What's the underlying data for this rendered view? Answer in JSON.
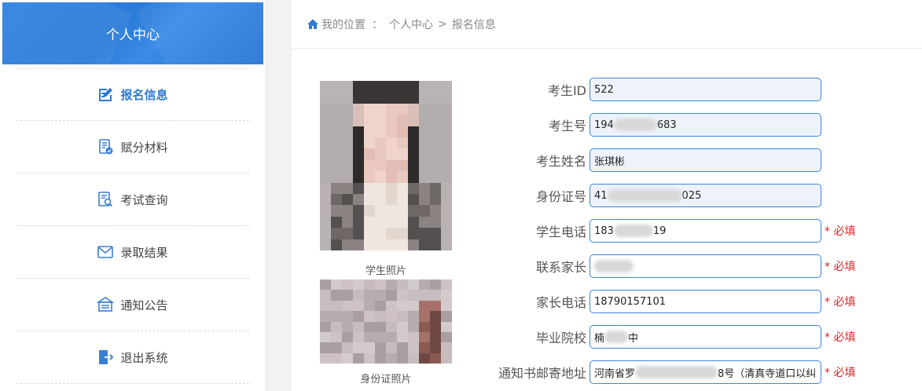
{
  "sidebar": {
    "title": "个人中心",
    "items": [
      {
        "label": "报名信息",
        "icon": "edit-form-icon",
        "active": true
      },
      {
        "label": "赋分材料",
        "icon": "document-check-icon",
        "active": false
      },
      {
        "label": "考试查询",
        "icon": "search-document-icon",
        "active": false
      },
      {
        "label": "录取结果",
        "icon": "mail-icon",
        "active": false
      },
      {
        "label": "通知公告",
        "icon": "announcement-icon",
        "active": false
      },
      {
        "label": "退出系统",
        "icon": "logout-icon",
        "active": false
      }
    ]
  },
  "breadcrumb": {
    "icon": "home-icon",
    "location_label": "我的位置",
    "colon": "：",
    "parent": "个人中心",
    "separator": ">",
    "current": "报名信息"
  },
  "photos": {
    "student_caption": "学生照片",
    "id_caption": "身份证照片"
  },
  "form": {
    "required_text": "* 必填",
    "fields": [
      {
        "label": "考生ID",
        "prefix": "522",
        "suffix": "",
        "readonly": true,
        "required": false
      },
      {
        "label": "考生号",
        "prefix": "194",
        "suffix": "683",
        "readonly": true,
        "required": false
      },
      {
        "label": "考生姓名",
        "prefix": "张琪彬",
        "suffix": "",
        "readonly": true,
        "required": false
      },
      {
        "label": "身份证号",
        "prefix": "41",
        "suffix": "025",
        "readonly": true,
        "required": false
      },
      {
        "label": "学生电话",
        "prefix": "183",
        "suffix": "19",
        "readonly": false,
        "required": true
      },
      {
        "label": "联系家长",
        "prefix": "",
        "suffix": "",
        "readonly": false,
        "required": true
      },
      {
        "label": "家长电话",
        "prefix": "18790157101",
        "suffix": "",
        "readonly": false,
        "required": true
      },
      {
        "label": "毕业院校",
        "prefix": "楠",
        "suffix": "中",
        "readonly": false,
        "required": true
      },
      {
        "label": "通知书邮寄地址",
        "prefix": "河南省罗",
        "suffix": "8号（清真寺道口以纠",
        "readonly": false,
        "required": true
      }
    ]
  },
  "colors": {
    "accent": "#2f7ad6",
    "header_bg": "#2b7bd8",
    "required": "#e02020",
    "input_border": "#3b86d8"
  }
}
